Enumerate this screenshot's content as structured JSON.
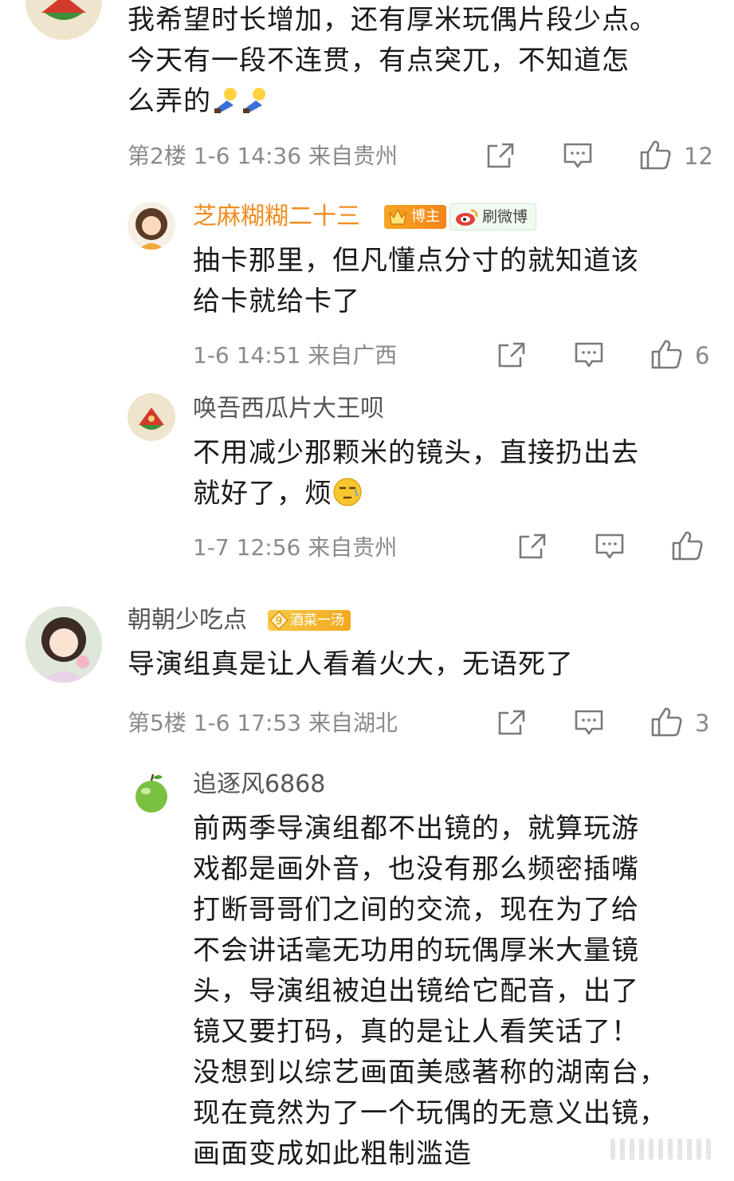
{
  "comments": [
    {
      "content_lines": [
        "我希望时长增加，还有厚米玩偶片段少点。",
        "今天有一段不连贯，有点突兀，不知道怎",
        "么弄的"
      ],
      "emoji": [
        "bow-emoji",
        "bow-emoji"
      ],
      "meta": "第2楼  1-6 14:36  来自贵州",
      "likes": "12",
      "replies": [
        {
          "username": "芝麻糊糊二十三",
          "badge": "博主",
          "badge_level": "5",
          "tag": "刷微博",
          "content_lines": [
            "抽卡那里，但凡懂点分寸的就知道该",
            "给卡就给卡了"
          ],
          "meta": "1-6 14:51  来自广西",
          "likes": "6"
        },
        {
          "username": "唤吾西瓜片大王呗",
          "content_lines": [
            "不用减少那颗米的镜头，直接扔出去",
            "就好了，烦"
          ],
          "emoji": [
            "speechless-emoji"
          ],
          "meta": "1-7 12:56  来自贵州",
          "likes": ""
        }
      ]
    },
    {
      "username": "朝朝少吃点",
      "fan_badge_level": "9",
      "fan_badge": "酒菜一汤",
      "content_lines": [
        "导演组真是让人看着火大，无语死了"
      ],
      "meta": "第5楼  1-6 17:53  来自湖北",
      "likes": "3",
      "replies": [
        {
          "username": "追逐风6868",
          "content_lines": [
            "前两季导演组都不出镜的，就算玩游",
            "戏都是画外音，也没有那么频密插嘴",
            "打断哥哥们之间的交流，现在为了给",
            "不会讲话毫无功用的玩偶厚米大量镜",
            "头，导演组被迫出镜给它配音，出了",
            "镜又要打码，真的是让人看笑话了！",
            "没想到以综艺画面美感著称的湖南台，",
            "现在竟然为了一个玩偶的无意义出镜，",
            "画面变成如此粗制滥造"
          ]
        }
      ]
    }
  ],
  "colors": {
    "orange_name": "#f08c1e",
    "meta_gray": "#8a8a8a",
    "icon_gray": "#7a7a7a"
  }
}
